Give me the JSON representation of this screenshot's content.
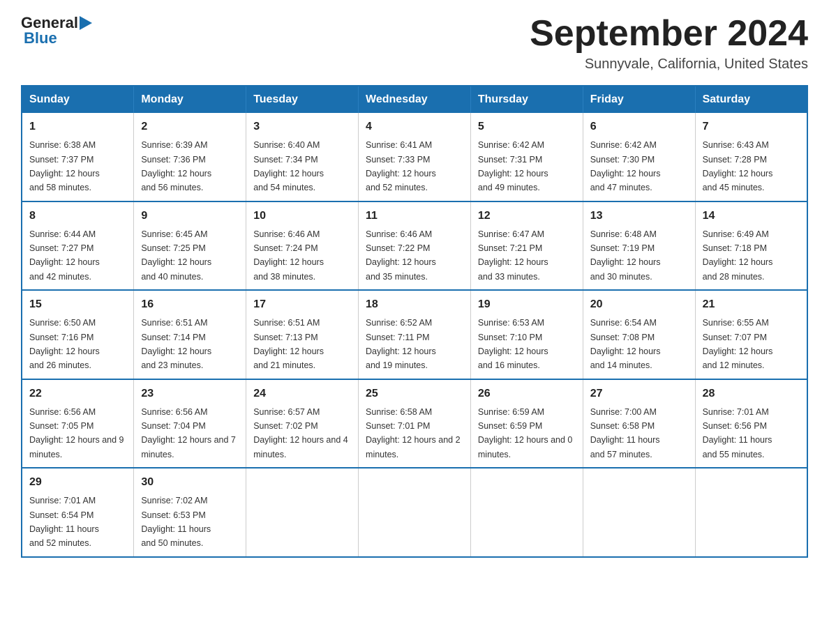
{
  "header": {
    "logo_general": "General",
    "logo_blue": "Blue",
    "title": "September 2024",
    "subtitle": "Sunnyvale, California, United States"
  },
  "days_of_week": [
    "Sunday",
    "Monday",
    "Tuesday",
    "Wednesday",
    "Thursday",
    "Friday",
    "Saturday"
  ],
  "weeks": [
    [
      {
        "day": "1",
        "sunrise": "6:38 AM",
        "sunset": "7:37 PM",
        "daylight": "12 hours and 58 minutes."
      },
      {
        "day": "2",
        "sunrise": "6:39 AM",
        "sunset": "7:36 PM",
        "daylight": "12 hours and 56 minutes."
      },
      {
        "day": "3",
        "sunrise": "6:40 AM",
        "sunset": "7:34 PM",
        "daylight": "12 hours and 54 minutes."
      },
      {
        "day": "4",
        "sunrise": "6:41 AM",
        "sunset": "7:33 PM",
        "daylight": "12 hours and 52 minutes."
      },
      {
        "day": "5",
        "sunrise": "6:42 AM",
        "sunset": "7:31 PM",
        "daylight": "12 hours and 49 minutes."
      },
      {
        "day": "6",
        "sunrise": "6:42 AM",
        "sunset": "7:30 PM",
        "daylight": "12 hours and 47 minutes."
      },
      {
        "day": "7",
        "sunrise": "6:43 AM",
        "sunset": "7:28 PM",
        "daylight": "12 hours and 45 minutes."
      }
    ],
    [
      {
        "day": "8",
        "sunrise": "6:44 AM",
        "sunset": "7:27 PM",
        "daylight": "12 hours and 42 minutes."
      },
      {
        "day": "9",
        "sunrise": "6:45 AM",
        "sunset": "7:25 PM",
        "daylight": "12 hours and 40 minutes."
      },
      {
        "day": "10",
        "sunrise": "6:46 AM",
        "sunset": "7:24 PM",
        "daylight": "12 hours and 38 minutes."
      },
      {
        "day": "11",
        "sunrise": "6:46 AM",
        "sunset": "7:22 PM",
        "daylight": "12 hours and 35 minutes."
      },
      {
        "day": "12",
        "sunrise": "6:47 AM",
        "sunset": "7:21 PM",
        "daylight": "12 hours and 33 minutes."
      },
      {
        "day": "13",
        "sunrise": "6:48 AM",
        "sunset": "7:19 PM",
        "daylight": "12 hours and 30 minutes."
      },
      {
        "day": "14",
        "sunrise": "6:49 AM",
        "sunset": "7:18 PM",
        "daylight": "12 hours and 28 minutes."
      }
    ],
    [
      {
        "day": "15",
        "sunrise": "6:50 AM",
        "sunset": "7:16 PM",
        "daylight": "12 hours and 26 minutes."
      },
      {
        "day": "16",
        "sunrise": "6:51 AM",
        "sunset": "7:14 PM",
        "daylight": "12 hours and 23 minutes."
      },
      {
        "day": "17",
        "sunrise": "6:51 AM",
        "sunset": "7:13 PM",
        "daylight": "12 hours and 21 minutes."
      },
      {
        "day": "18",
        "sunrise": "6:52 AM",
        "sunset": "7:11 PM",
        "daylight": "12 hours and 19 minutes."
      },
      {
        "day": "19",
        "sunrise": "6:53 AM",
        "sunset": "7:10 PM",
        "daylight": "12 hours and 16 minutes."
      },
      {
        "day": "20",
        "sunrise": "6:54 AM",
        "sunset": "7:08 PM",
        "daylight": "12 hours and 14 minutes."
      },
      {
        "day": "21",
        "sunrise": "6:55 AM",
        "sunset": "7:07 PM",
        "daylight": "12 hours and 12 minutes."
      }
    ],
    [
      {
        "day": "22",
        "sunrise": "6:56 AM",
        "sunset": "7:05 PM",
        "daylight": "12 hours and 9 minutes."
      },
      {
        "day": "23",
        "sunrise": "6:56 AM",
        "sunset": "7:04 PM",
        "daylight": "12 hours and 7 minutes."
      },
      {
        "day": "24",
        "sunrise": "6:57 AM",
        "sunset": "7:02 PM",
        "daylight": "12 hours and 4 minutes."
      },
      {
        "day": "25",
        "sunrise": "6:58 AM",
        "sunset": "7:01 PM",
        "daylight": "12 hours and 2 minutes."
      },
      {
        "day": "26",
        "sunrise": "6:59 AM",
        "sunset": "6:59 PM",
        "daylight": "12 hours and 0 minutes."
      },
      {
        "day": "27",
        "sunrise": "7:00 AM",
        "sunset": "6:58 PM",
        "daylight": "11 hours and 57 minutes."
      },
      {
        "day": "28",
        "sunrise": "7:01 AM",
        "sunset": "6:56 PM",
        "daylight": "11 hours and 55 minutes."
      }
    ],
    [
      {
        "day": "29",
        "sunrise": "7:01 AM",
        "sunset": "6:54 PM",
        "daylight": "11 hours and 52 minutes."
      },
      {
        "day": "30",
        "sunrise": "7:02 AM",
        "sunset": "6:53 PM",
        "daylight": "11 hours and 50 minutes."
      },
      null,
      null,
      null,
      null,
      null
    ]
  ],
  "labels": {
    "sunrise_prefix": "Sunrise: ",
    "sunset_prefix": "Sunset: ",
    "daylight_prefix": "Daylight: "
  }
}
